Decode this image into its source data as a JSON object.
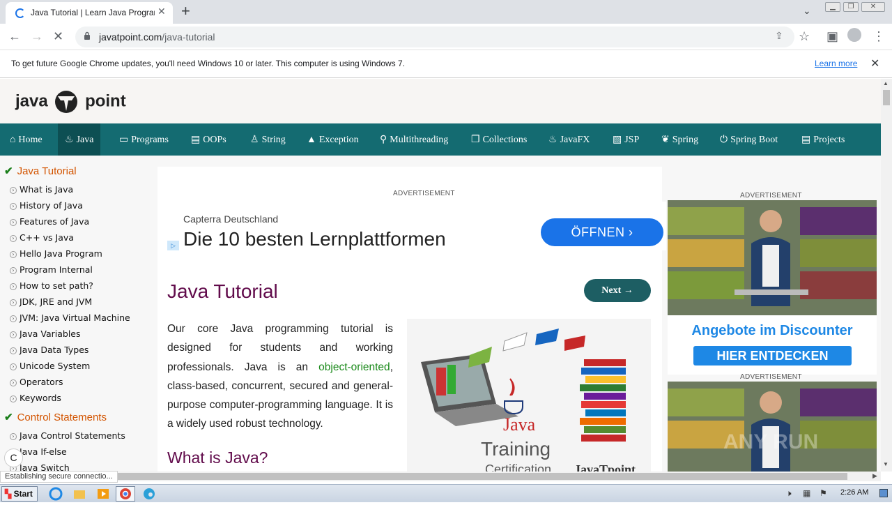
{
  "browser": {
    "tab_title": "Java Tutorial | Learn Java Programming",
    "url_domain": "javatpoint.com",
    "url_path": "/java-tutorial",
    "infobar_message": "To get future Google Chrome updates, you'll need Windows 10 or later. This computer is using Windows 7.",
    "infobar_link": "Learn more",
    "status_text": "Establishing secure connectio..."
  },
  "site": {
    "logo_left": "java",
    "logo_right": "point",
    "nav": [
      {
        "label": "Home",
        "icon": "home-icon"
      },
      {
        "label": "Java",
        "icon": "java-cup-icon"
      },
      {
        "label": "Programs",
        "icon": "monitor-icon"
      },
      {
        "label": "OOPs",
        "icon": "oops-icon"
      },
      {
        "label": "String",
        "icon": "string-icon"
      },
      {
        "label": "Exception",
        "icon": "warning-icon"
      },
      {
        "label": "Multithreading",
        "icon": "thread-icon"
      },
      {
        "label": "Collections",
        "icon": "copy-icon"
      },
      {
        "label": "JavaFX",
        "icon": "javafx-icon"
      },
      {
        "label": "JSP",
        "icon": "jsp-icon"
      },
      {
        "label": "Spring",
        "icon": "spring-icon"
      },
      {
        "label": "Spring Boot",
        "icon": "power-icon"
      },
      {
        "label": "Projects",
        "icon": "projects-icon"
      }
    ],
    "sidebar": {
      "section1": "Java Tutorial",
      "items1": [
        "What is Java",
        "History of Java",
        "Features of Java",
        "C++ vs Java",
        "Hello Java Program",
        "Program Internal",
        "How to set path?",
        "JDK, JRE and JVM",
        "JVM: Java Virtual Machine",
        "Java Variables",
        "Java Data Types",
        "Unicode System",
        "Operators",
        "Keywords"
      ],
      "section2": "Control Statements",
      "items2": [
        "Java Control Statements",
        "Java If-else",
        "Java Switch"
      ]
    },
    "content": {
      "ad_label": "ADVERTISEMENT",
      "ad_brand": "Capterra Deutschland",
      "ad_headline": "Die 10 besten Lernplattformen",
      "ad_button": "ÖFFNEN",
      "title": "Java Tutorial",
      "next_button": "Next →",
      "intro_before": "Our core Java programming tutorial is designed for students and working professionals. Java is an ",
      "intro_link": "object-oriented",
      "intro_after": ", class-based, concurrent, secured and general-purpose computer-programming language. It is a widely used robust technology.",
      "subtitle": "What is Java?",
      "illus_line1": "Java",
      "illus_line2": "Training",
      "illus_line3": "Certification",
      "illus_brand": "JavaTpoint"
    },
    "right_ads": {
      "label": "ADVERTISEMENT",
      "tagline": "Angebote im Discounter",
      "button": "HIER ENTDECKEN",
      "watermark": "ANY RUN"
    }
  },
  "taskbar": {
    "start": "Start",
    "clock": "2:26 AM"
  },
  "colors": {
    "nav_bg": "#146b71",
    "nav_active": "#0d4f53",
    "title": "#610b4b",
    "sidebar_head": "#d35400",
    "link_green": "#1b8a1b"
  }
}
